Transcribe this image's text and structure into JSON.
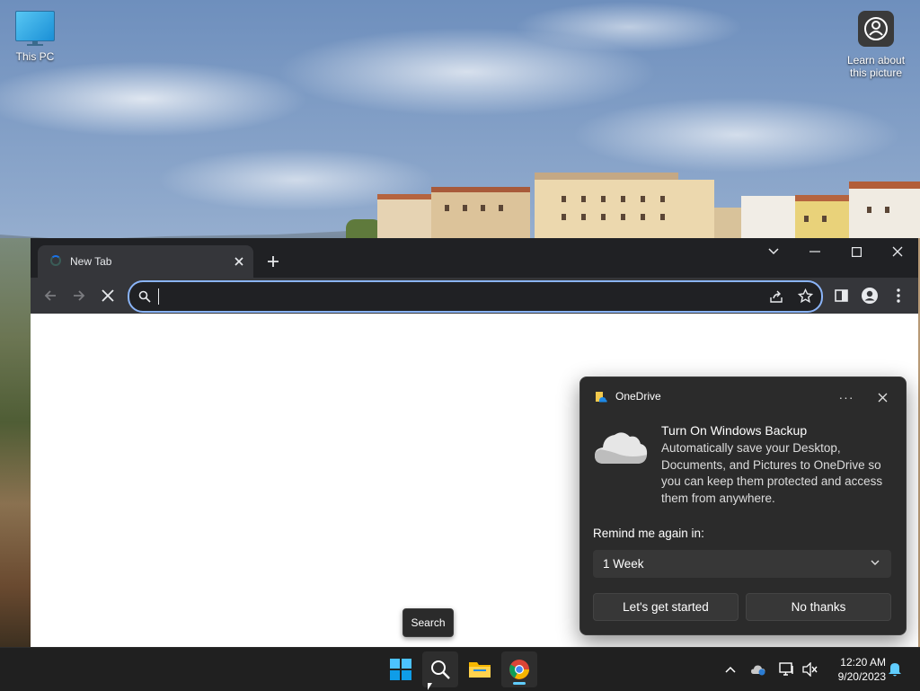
{
  "desktop": {
    "icons": [
      {
        "label": "This PC"
      },
      {
        "label": "Learn about this picture"
      }
    ]
  },
  "browser": {
    "tab": {
      "title": "New Tab"
    },
    "omnibox": {
      "value": "",
      "placeholder": ""
    }
  },
  "tooltip": {
    "text": "Search"
  },
  "toast": {
    "app_name": "OneDrive",
    "more_label": "···",
    "heading": "Turn On Windows Backup",
    "body": "Automatically save your Desktop, Documents, and Pictures to OneDrive so you can keep them protected and access them from anywhere.",
    "remind_label": "Remind me again in:",
    "remind_selected": "1 Week",
    "primary_button": "Let's get started",
    "secondary_button": "No thanks"
  },
  "taskbar": {
    "clock": {
      "time": "12:20 AM",
      "date": "9/20/2023"
    }
  },
  "colors": {
    "taskbar_bg": "#202020",
    "toast_bg": "#2b2b2b",
    "browser_frame": "#202124",
    "omnibox_focus": "#8ab4f8",
    "accent": "#60cdff"
  }
}
